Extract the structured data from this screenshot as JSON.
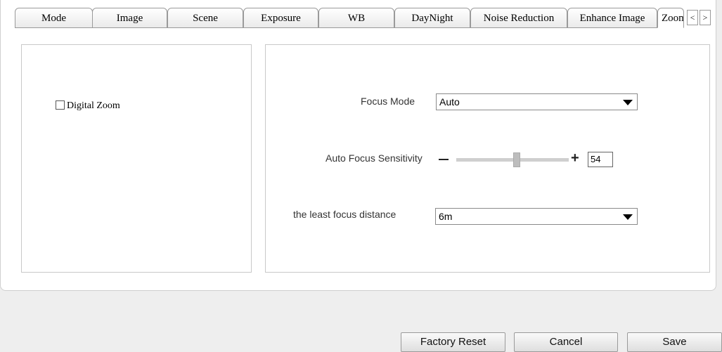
{
  "tabs": [
    {
      "label": "Mode"
    },
    {
      "label": "Image"
    },
    {
      "label": "Scene"
    },
    {
      "label": "Exposure"
    },
    {
      "label": "WB"
    },
    {
      "label": "DayNight"
    },
    {
      "label": "Noise Reduction"
    },
    {
      "label": "Enhance Image"
    },
    {
      "label": "Zoom"
    }
  ],
  "tab_scroll": {
    "prev": "<",
    "next": ">"
  },
  "left_panel": {
    "digital_zoom": {
      "label": "Digital Zoom",
      "checked": false
    }
  },
  "right_panel": {
    "focus_mode": {
      "label": "Focus Mode",
      "value": "Auto"
    },
    "af_sensitivity": {
      "label": "Auto Focus Sensitivity",
      "minus": "—",
      "plus": "+",
      "value": "54",
      "level": 54
    },
    "least_focus_distance": {
      "label": "the least focus distance",
      "value": "6m"
    }
  },
  "buttons": {
    "factory_reset": "Factory Reset",
    "cancel": "Cancel",
    "save": "Save"
  }
}
